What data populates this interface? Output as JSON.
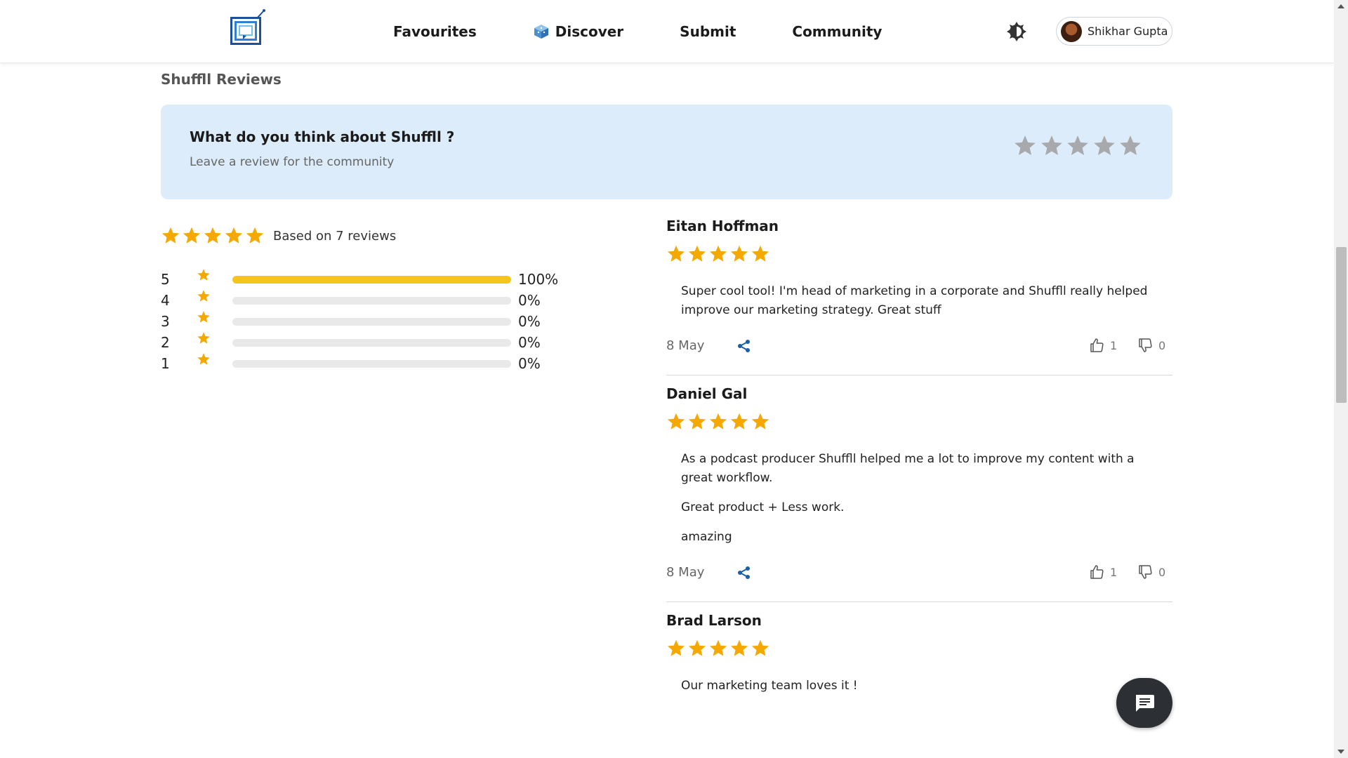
{
  "header": {
    "nav": [
      {
        "label": "Favourites"
      },
      {
        "label": "Discover"
      },
      {
        "label": "Submit"
      },
      {
        "label": "Community"
      }
    ],
    "user_name": "Shikhar Gupta"
  },
  "section_title": "Shuffll Reviews",
  "prompt": {
    "title": "What do you think about Shuffll ?",
    "subtitle": "Leave a review for the community"
  },
  "summary": {
    "stars": 5,
    "text": "Based on 7 reviews",
    "distribution": [
      {
        "rating": "5",
        "percent": 100,
        "label": "100%"
      },
      {
        "rating": "4",
        "percent": 0,
        "label": "0%"
      },
      {
        "rating": "3",
        "percent": 0,
        "label": "0%"
      },
      {
        "rating": "2",
        "percent": 0,
        "label": "0%"
      },
      {
        "rating": "1",
        "percent": 0,
        "label": "0%"
      }
    ]
  },
  "reviews": [
    {
      "name": "Eitan Hoffman",
      "stars": 5,
      "paragraphs": [
        "Super cool tool! I'm head of marketing in a corporate and Shuffll really helped improve our marketing strategy. Great stuff"
      ],
      "date": "8 May",
      "likes": "1",
      "dislikes": "0"
    },
    {
      "name": "Daniel Gal",
      "stars": 5,
      "paragraphs": [
        "As a podcast producer Shuffll helped me a lot to improve my content with a great workflow.",
        "Great product + Less work.",
        "amazing"
      ],
      "date": "8 May",
      "likes": "1",
      "dislikes": "0"
    },
    {
      "name": "Brad Larson",
      "stars": 5,
      "paragraphs": [
        "Our marketing team loves it !"
      ]
    }
  ],
  "colors": {
    "star_gold": "#f5a800",
    "bar_fill": "#f5c518",
    "prompt_bg": "#dcecfb",
    "share_blue": "#1a5fa8"
  }
}
